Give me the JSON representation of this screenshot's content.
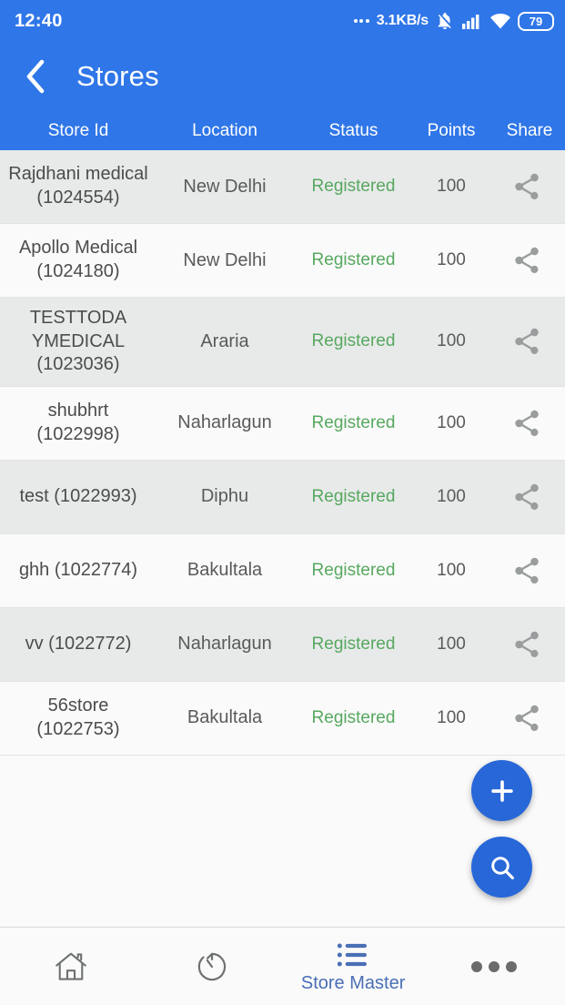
{
  "statusbar": {
    "time": "12:40",
    "network_speed": "3.1KB/s",
    "battery_level": "79",
    "icons": [
      "notifications-off-icon",
      "cellular-signal-icon",
      "wifi-icon",
      "battery-icon"
    ]
  },
  "appbar": {
    "back_label": "back-chevron-icon",
    "title": "Stores",
    "background_color": "#2f76e8"
  },
  "table": {
    "columns": [
      "Store Id",
      "Location",
      "Status",
      "Points",
      "Share"
    ],
    "rows": [
      {
        "store": "Rajdhani medical (1024554)",
        "location": "New Delhi",
        "status": "Registered",
        "points": "100",
        "share": "share-icon"
      },
      {
        "store": "Apollo Medical (1024180)",
        "location": "New Delhi",
        "status": "Registered",
        "points": "100",
        "share": "share-icon"
      },
      {
        "store": "TESTTODA YMEDICAL (1023036)",
        "location": "Araria",
        "status": "Registered",
        "points": "100",
        "share": "share-icon"
      },
      {
        "store": "shubhrt (1022998)",
        "location": "Naharlagun",
        "status": "Registered",
        "points": "100",
        "share": "share-icon"
      },
      {
        "store": "test (1022993)",
        "location": "Diphu",
        "status": "Registered",
        "points": "100",
        "share": "share-icon"
      },
      {
        "store": "ghh (1022774)",
        "location": "Bakultala",
        "status": "Registered",
        "points": "100",
        "share": "share-icon"
      },
      {
        "store": "vv (1022772)",
        "location": "Naharlagun",
        "status": "Registered",
        "points": "100",
        "share": "share-icon"
      },
      {
        "store": "56store (1022753)",
        "location": "Bakultala",
        "status": "Registered",
        "points": "100",
        "share": "share-icon"
      }
    ],
    "status_color": "#57a85f",
    "row_alt_color": "#e8eaea"
  },
  "fabs": {
    "add_label": "add-icon",
    "search_label": "search-icon",
    "color": "#2767d8"
  },
  "bottomnav": {
    "items": [
      {
        "icon": "home-icon",
        "label": ""
      },
      {
        "icon": "history-icon",
        "label": ""
      },
      {
        "icon": "list-icon",
        "label": "Store Master"
      },
      {
        "icon": "more-horiz-icon",
        "label": ""
      }
    ],
    "active_color": "#4a6fb5"
  }
}
